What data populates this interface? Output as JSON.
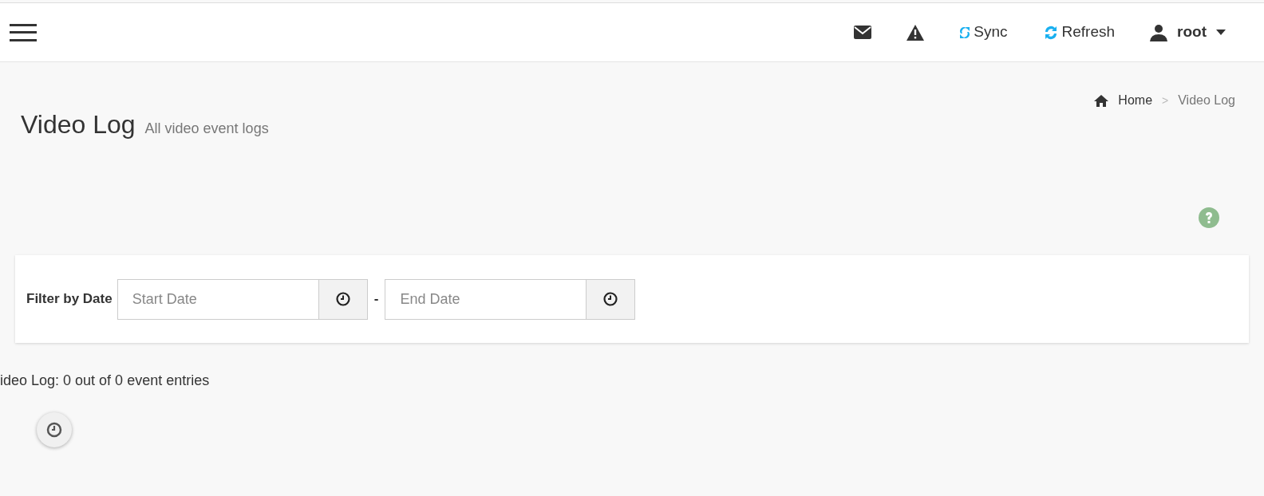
{
  "topbar": {
    "actions": [
      {
        "kind": "mail"
      },
      {
        "kind": "alert"
      },
      {
        "kind": "sync",
        "label": "Sync"
      },
      {
        "kind": "refresh",
        "label": "Refresh"
      },
      {
        "kind": "user",
        "label": "root"
      }
    ]
  },
  "page_header": {
    "title": "Video Log",
    "subtitle": "All video event logs"
  },
  "breadcrumb": [
    {
      "label": "Home",
      "kind": "home"
    },
    {
      "label": ">",
      "kind": "separator"
    },
    {
      "label": "Video Log",
      "kind": "current"
    }
  ],
  "filter": {
    "label": "Filter by Date",
    "start": {
      "placeholder": "Start Date"
    },
    "separator": "-",
    "end": {
      "placeholder": "End Date"
    }
  },
  "summary": "ideo Log: 0 out of 0 event entries"
}
